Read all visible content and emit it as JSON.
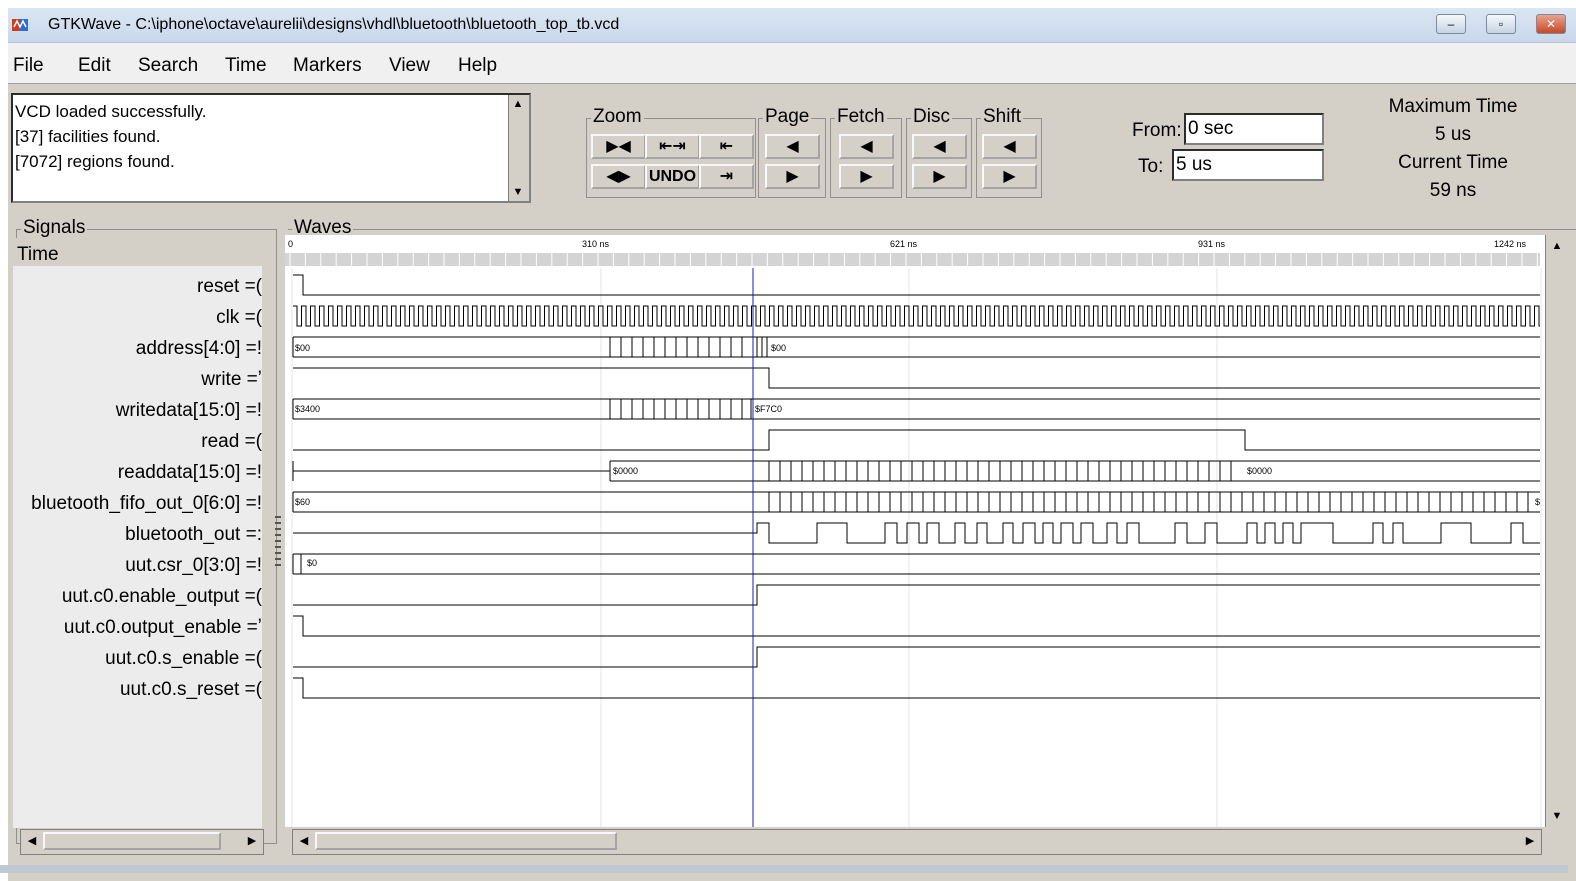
{
  "window": {
    "title": "GTKWave - C:\\iphone\\octave\\aurelii\\designs\\vhdl\\bluetooth\\bluetooth_top_tb.vcd",
    "buttons": {
      "minimize": "‒",
      "restore": "▫",
      "close": "✕"
    }
  },
  "menu": [
    "File",
    "Edit",
    "Search",
    "Time",
    "Markers",
    "View",
    "Help"
  ],
  "log": {
    "line1": "VCD loaded successfully.",
    "line2": "[37] facilities found.",
    "line3": "[7072] regions found."
  },
  "toolbar": {
    "zoom_label": "Zoom",
    "page_label": "Page",
    "fetch_label": "Fetch",
    "disc_label": "Disc",
    "shift_label": "Shift",
    "undo_label": "UNDO",
    "zoom_fit": "▶◀",
    "zoom_in": "⇤⇥",
    "zoom_start": "⇤",
    "zoom_out": "◀▶",
    "zoom_end": "⇥",
    "left": "◀",
    "right": "▶"
  },
  "time_range": {
    "from_label": "From:",
    "from_value": "0 sec",
    "to_label": "To:",
    "to_value": "5 us"
  },
  "info": {
    "max_time_label": "Maximum Time",
    "max_time_value": "5 us",
    "current_time_label": "Current Time",
    "current_time_value": "59 ns"
  },
  "signals_panel": {
    "label": "Signals",
    "time_header": "Time",
    "signals": [
      "reset =(",
      "clk =(",
      "address[4:0] =!",
      "write =ʼ",
      "writedata[15:0] =!",
      "read =(",
      "readdata[15:0] =!",
      "bluetooth_fifo_out_0[6:0] =!",
      "bluetooth_out =:",
      "uut.csr_0[3:0] =!",
      "uut.c0.enable_output =(",
      "uut.c0.output_enable =ʼ",
      "uut.c0.s_enable =(",
      "uut.c0.s_reset =("
    ]
  },
  "waves_panel": {
    "label": "Waves",
    "ruler_ticks": [
      "0",
      "310 ns",
      "621 ns",
      "931 ns",
      "1242 ns"
    ],
    "bus_values": {
      "address_a": "$00",
      "address_b": "$00",
      "writedata_a": "$3400",
      "writedata_b": "$F7C0",
      "readdata_a": "$0000",
      "readdata_b": "$0000",
      "fifo_a": "$60",
      "fifo_b": "$",
      "csr": "$0"
    }
  },
  "colors": {
    "cursor": "#1c1cb0",
    "wave": "#000000",
    "panel": "#d4d0c8"
  }
}
